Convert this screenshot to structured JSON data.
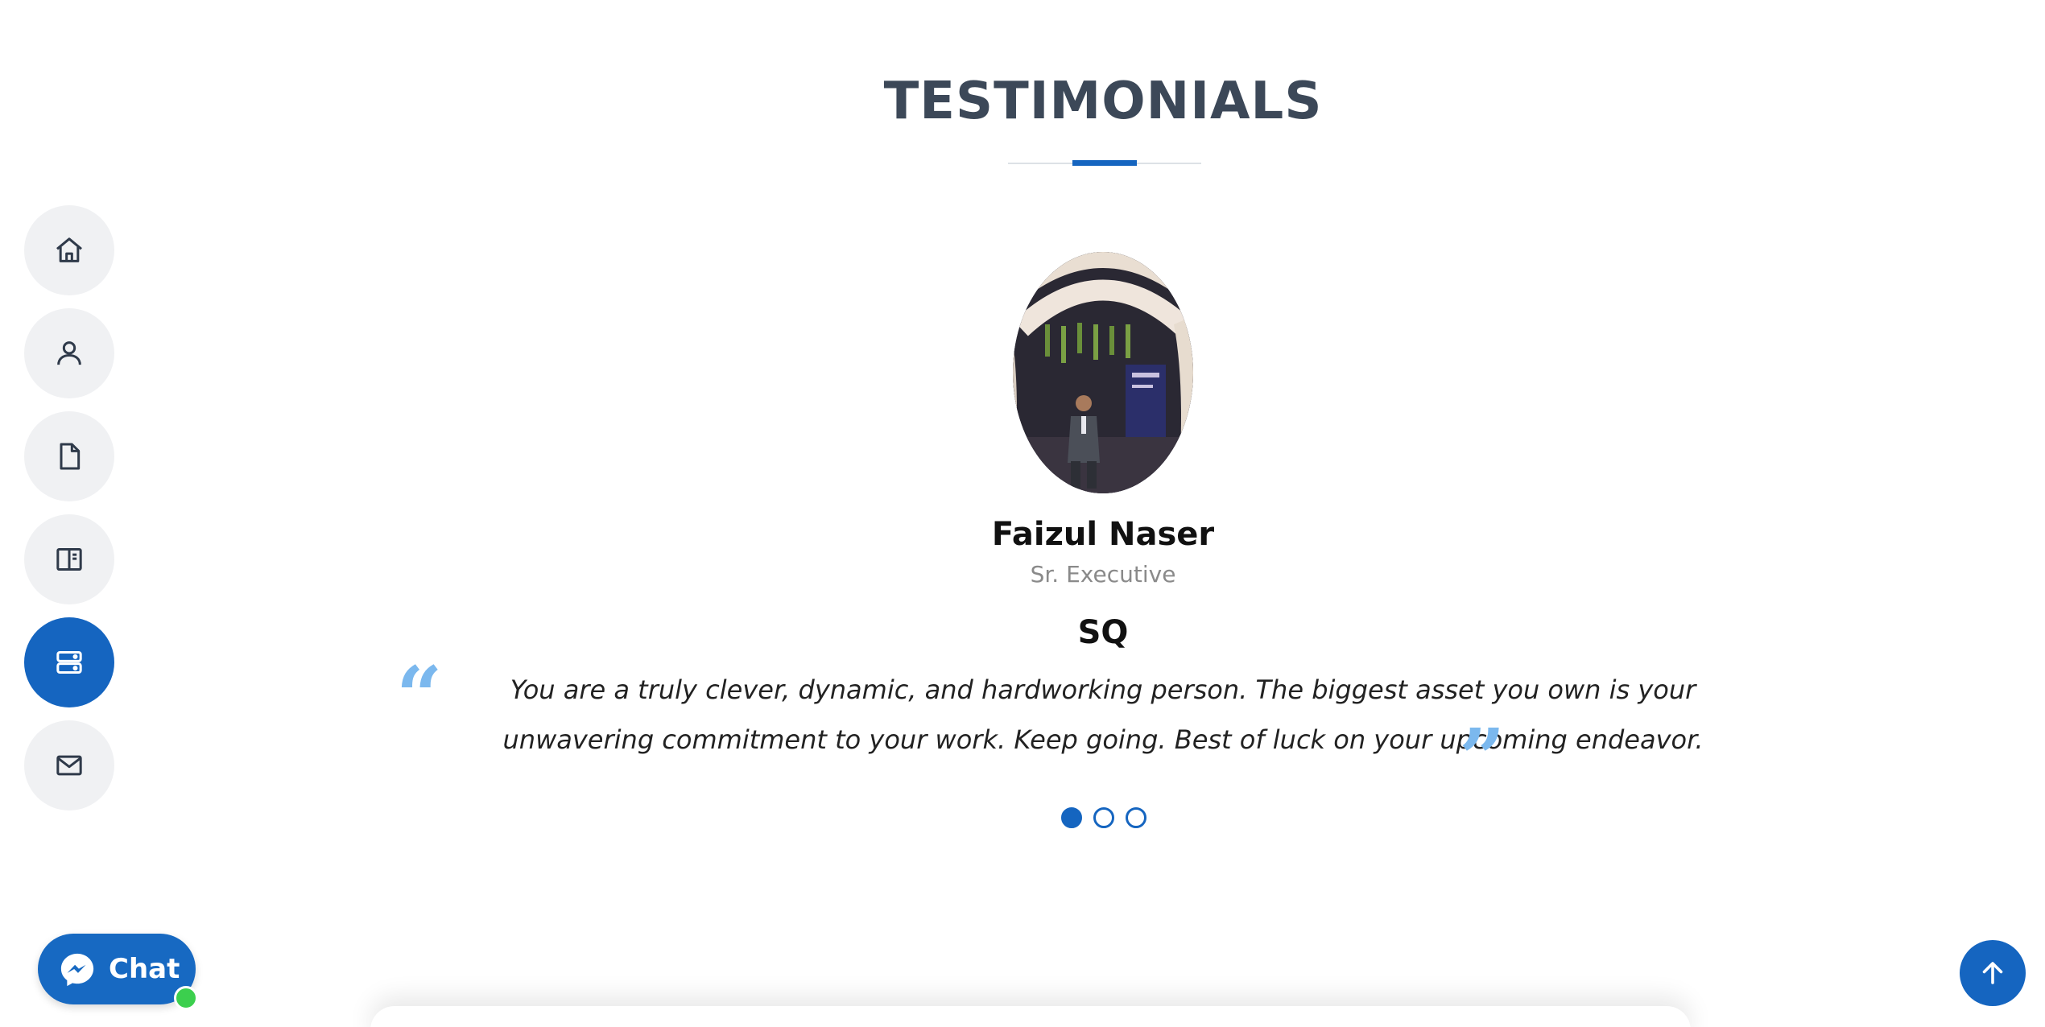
{
  "section": {
    "title": "TESTIMONIALS"
  },
  "side_nav": {
    "items": [
      {
        "icon": "home-icon",
        "active": false
      },
      {
        "icon": "user-icon",
        "active": false
      },
      {
        "icon": "file-icon",
        "active": false
      },
      {
        "icon": "book-open-icon",
        "active": false
      },
      {
        "icon": "server-icon",
        "active": true
      },
      {
        "icon": "mail-icon",
        "active": false
      }
    ],
    "active_color": "#1565c0",
    "inactive_color": "#f0f1f3"
  },
  "testimonial": {
    "avatar_icon": "person-photo",
    "name": "Faizul Naser",
    "role": "Sr. Executive",
    "company": "SQ",
    "open_quote": "“",
    "close_quote": "”",
    "quote": "You are a truly clever, dynamic, and hardworking person. The biggest asset you own is your unwavering commitment to your work. Keep going. Best of luck on your upcoming endeavor."
  },
  "carousel": {
    "total": 3,
    "active_index": 0
  },
  "chat": {
    "label": "Chat",
    "icon": "messenger-icon",
    "status_color": "#3ccf4e"
  },
  "back_to_top": {
    "icon": "arrow-up-icon"
  },
  "colors": {
    "accent": "#1565c0",
    "quote_mark": "#7bb8ee",
    "title": "#3c4858"
  }
}
